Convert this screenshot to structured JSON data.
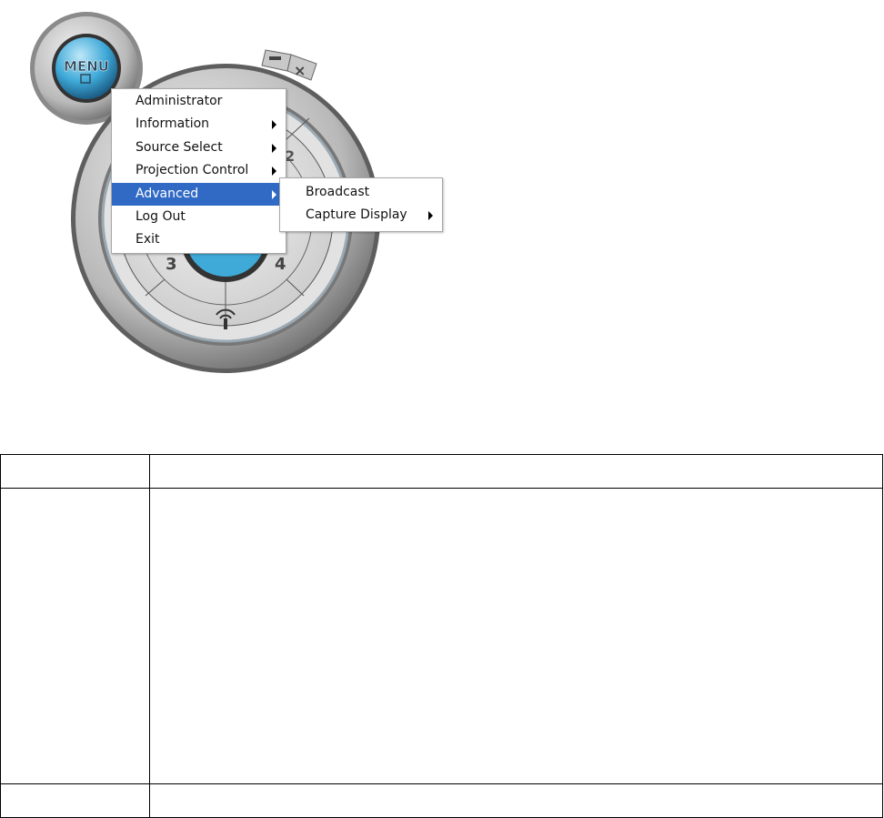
{
  "widget": {
    "menu_button_label": "MENU",
    "minimize_icon": "minimize-icon",
    "close_icon": "close-icon",
    "quadrant_labels": [
      "2",
      "3",
      "4"
    ],
    "accent": "#3fa9d8"
  },
  "main_menu": {
    "items": [
      {
        "label": "Administrator",
        "submenu": false
      },
      {
        "label": "Information",
        "submenu": true
      },
      {
        "label": "Source Select",
        "submenu": true
      },
      {
        "label": "Projection Control",
        "submenu": true
      },
      {
        "label": "Advanced",
        "submenu": true,
        "highlighted": true
      },
      {
        "label": "Log Out",
        "submenu": false
      },
      {
        "label": "Exit",
        "submenu": false
      }
    ],
    "highlight_color": "#316ac5"
  },
  "sub_menu": {
    "items": [
      {
        "label": "Broadcast",
        "submenu": false
      },
      {
        "label": "Capture Display",
        "submenu": true
      }
    ]
  }
}
